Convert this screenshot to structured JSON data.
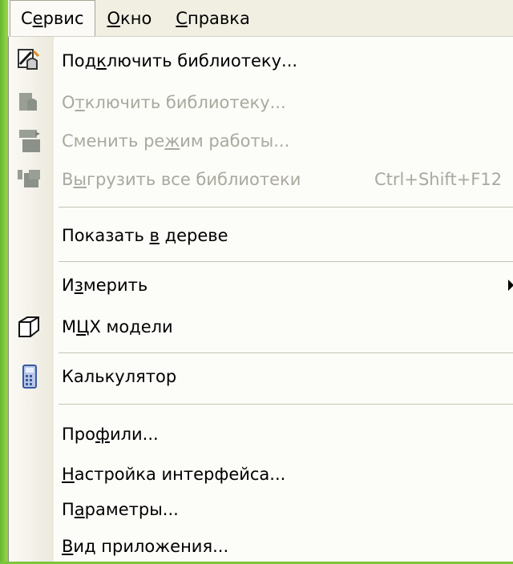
{
  "menubar": {
    "items": [
      {
        "label_pre": "С",
        "label_ul": "е",
        "label_post": "рвис"
      },
      {
        "label_pre": "",
        "label_ul": "О",
        "label_post": "кно"
      },
      {
        "label_pre": "",
        "label_ul": "С",
        "label_post": "правка"
      }
    ]
  },
  "menu": {
    "items": [
      {
        "pre": "Под",
        "ul": "к",
        "post": "лючить библиотеку...",
        "shortcut": "",
        "icon": "connect-library-icon",
        "disabled": false
      },
      {
        "pre": "О",
        "ul": "т",
        "post": "ключить библиотеку...",
        "shortcut": "",
        "icon": "disconnect-library-icon",
        "disabled": true
      },
      {
        "pre": "Сменить ре",
        "ul": "ж",
        "post": "им работы...",
        "shortcut": "",
        "icon": "switch-mode-icon",
        "disabled": true
      },
      {
        "pre": "В",
        "ul": "ы",
        "post": "грузить все библиотеки",
        "shortcut": "Ctrl+Shift+F12",
        "icon": "unload-libraries-icon",
        "disabled": true
      },
      {
        "pre": "Показать ",
        "ul": "в",
        "post": " дереве",
        "shortcut": "",
        "icon": "",
        "disabled": false
      },
      {
        "pre": "И",
        "ul": "з",
        "post": "мерить",
        "shortcut": "",
        "icon": "",
        "disabled": false
      },
      {
        "pre": "М",
        "ul": "Ц",
        "post": "Х модели",
        "shortcut": "",
        "icon": "mass-properties-icon",
        "disabled": false
      },
      {
        "pre": "Калькулятор",
        "ul": "",
        "post": "",
        "shortcut": "",
        "icon": "calculator-icon",
        "disabled": false
      },
      {
        "pre": "Про",
        "ul": "ф",
        "post": "или...",
        "shortcut": "",
        "icon": "",
        "disabled": false
      },
      {
        "pre": "",
        "ul": "Н",
        "post": "астройка интерфейса...",
        "shortcut": "",
        "icon": "",
        "disabled": false
      },
      {
        "pre": "П",
        "ul": "а",
        "post": "раметры...",
        "shortcut": "",
        "icon": "",
        "disabled": false
      },
      {
        "pre": "",
        "ul": "В",
        "post": "ид приложения...",
        "shortcut": "",
        "icon": "",
        "disabled": false
      }
    ]
  }
}
